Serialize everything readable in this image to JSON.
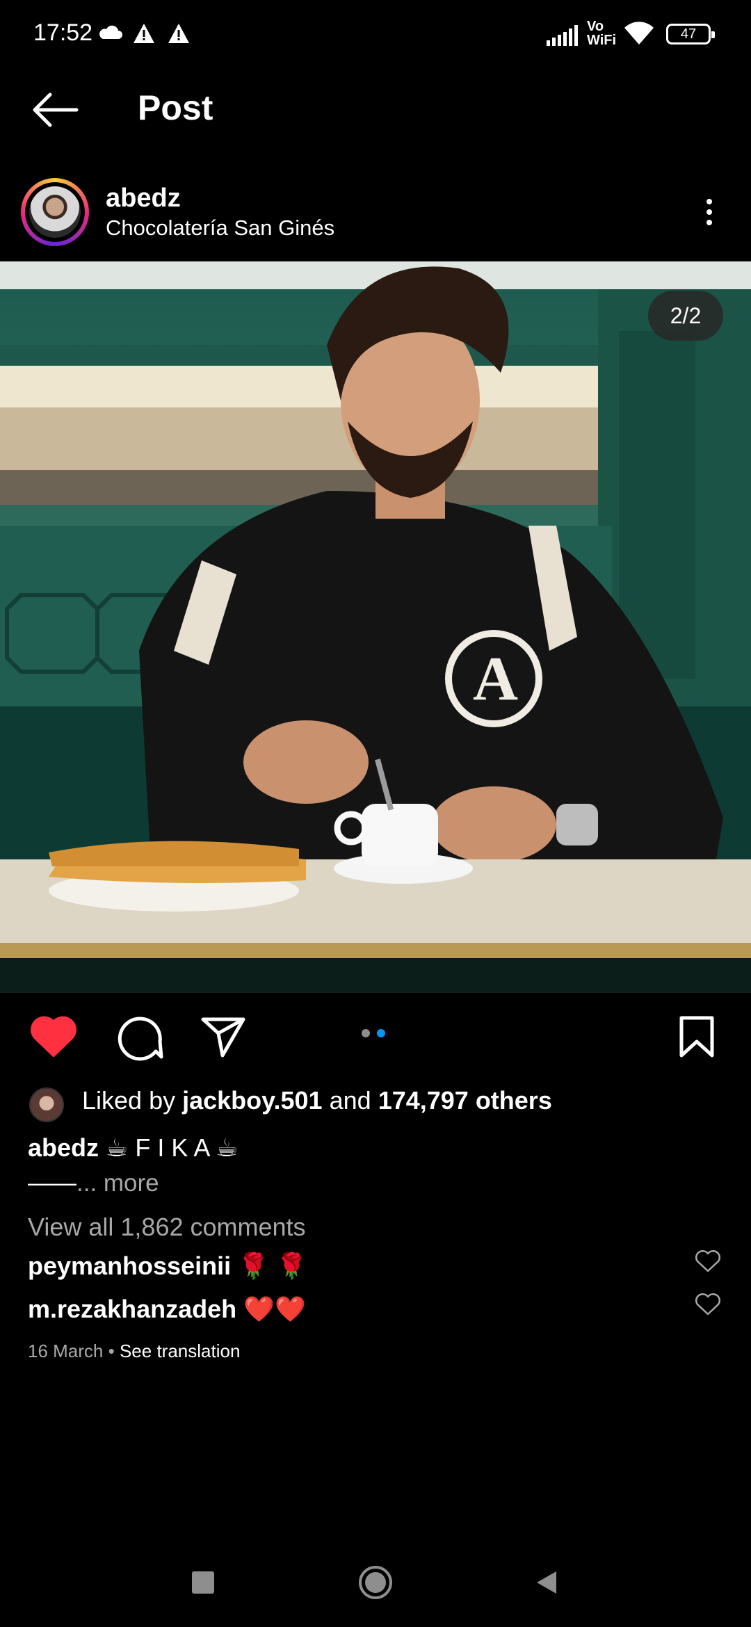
{
  "status_bar": {
    "time": "17:52",
    "battery": "47",
    "network_label": "Vo WiFi"
  },
  "header": {
    "title": "Post"
  },
  "post": {
    "username": "abedz",
    "location": "Chocolatería San Ginés",
    "photo_counter": "2/2",
    "carousel": {
      "count": 2,
      "active": 2
    }
  },
  "likes": {
    "prefix": "Liked by",
    "user": "jackboy.501",
    "connector": "and",
    "others": "174,797 others"
  },
  "caption": {
    "username": "abedz",
    "text": "☕ F I K A ☕",
    "second_line": "——",
    "more": "... more"
  },
  "comments": {
    "view_all": "View all 1,862 comments",
    "items": [
      {
        "user": "peymanhosseinii",
        "text": "🌹 🌹"
      },
      {
        "user": "m.rezakhanzadeh",
        "text": "❤️❤️"
      }
    ]
  },
  "footer": {
    "date": "16 March",
    "separator": "•",
    "see_translation": "See translation"
  },
  "colors": {
    "like_red": "#ff3040",
    "dot_active": "#0095f6",
    "dot_inactive": "#8e8e8e",
    "muted_text": "#a8a8a8"
  },
  "icons": [
    "cloud-icon",
    "warning-icon",
    "signal-icon",
    "wifi-icon",
    "battery-icon",
    "back-arrow-icon",
    "more-vertical-icon",
    "heart-icon",
    "comment-icon",
    "share-icon",
    "bookmark-icon",
    "heart-outline-icon"
  ]
}
